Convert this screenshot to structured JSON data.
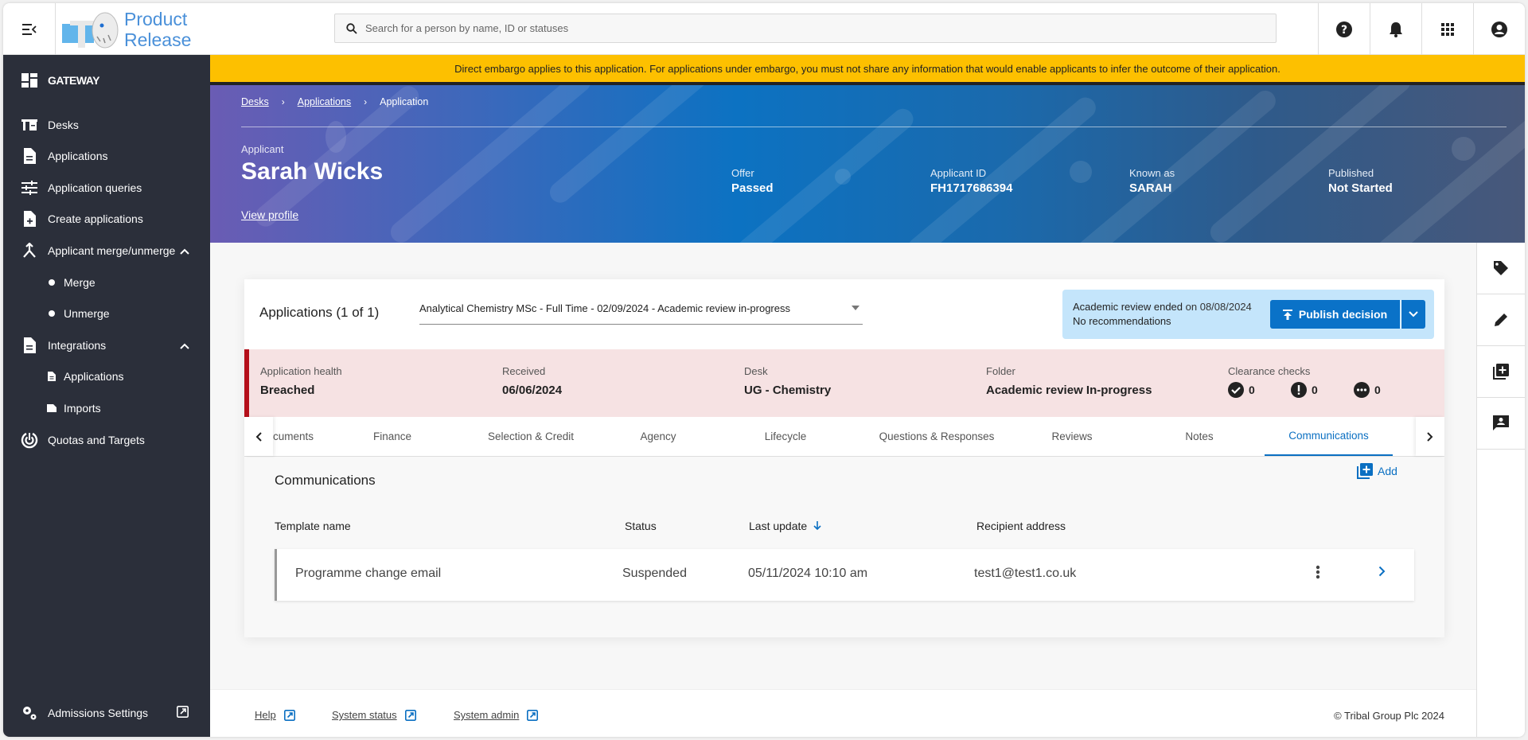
{
  "header": {
    "logo_text_line1": "Product",
    "logo_text_line2": "Release",
    "search_placeholder": "Search for a person by name, ID or statuses",
    "icons": [
      "help-icon",
      "bell-icon",
      "apps-grid-icon",
      "account-icon"
    ]
  },
  "sidebar": {
    "title": "GATEWAY",
    "items": [
      {
        "label": "Desks",
        "icon": "desk-icon"
      },
      {
        "label": "Applications",
        "icon": "document-icon"
      },
      {
        "label": "Application queries",
        "icon": "sliders-icon"
      },
      {
        "label": "Create applications",
        "icon": "document-add-icon"
      },
      {
        "label": "Applicant merge/unmerge",
        "icon": "merge-icon",
        "expanded": true,
        "children": [
          {
            "label": "Merge"
          },
          {
            "label": "Unmerge"
          }
        ]
      },
      {
        "label": "Integrations",
        "icon": "document-icon",
        "expanded": true,
        "children": [
          {
            "label": "Applications"
          },
          {
            "label": "Imports"
          }
        ]
      },
      {
        "label": "Quotas and Targets",
        "icon": "target-icon"
      }
    ],
    "bottom": {
      "label": "Admissions Settings"
    }
  },
  "banner": {
    "text": "Direct embargo applies to this application. For applications under embargo, you must not share any information that would enable applicants to infer the outcome of their application.",
    "color": "#fdc000"
  },
  "breadcrumb": [
    "Desks",
    "Applications",
    "Application"
  ],
  "applicant": {
    "label": "Applicant",
    "name": "Sarah Wicks",
    "view_profile": "View profile",
    "fields": [
      {
        "label": "Offer",
        "value": "Passed"
      },
      {
        "label": "Applicant ID",
        "value": "FH1717686394"
      },
      {
        "label": "Known as",
        "value": "SARAH"
      },
      {
        "label": "Published",
        "value": "Not Started"
      }
    ]
  },
  "applications": {
    "title": "Applications (1 of 1)",
    "selected": "Analytical Chemistry MSc - Full Time - 02/09/2024 - Academic review in-progress",
    "review": {
      "bold": "Academic review ended",
      "rest": " on 08/08/2024",
      "line2": "No recommendations"
    },
    "publish_label": "Publish decision"
  },
  "health": {
    "fields": [
      {
        "label": "Application health",
        "value": "Breached"
      },
      {
        "label": "Received",
        "value": "06/06/2024"
      },
      {
        "label": "Desk",
        "value": "UG - Chemistry"
      },
      {
        "label": "Folder",
        "value": "Academic review In-progress"
      }
    ],
    "clearance": {
      "label": "Clearance checks",
      "passed": "0",
      "warning": "0",
      "pending": "0"
    },
    "accent": "#b40f1a"
  },
  "tabs": [
    {
      "label": "cuments"
    },
    {
      "label": "Finance"
    },
    {
      "label": "Selection & Credit"
    },
    {
      "label": "Agency"
    },
    {
      "label": "Lifecycle"
    },
    {
      "label": "Questions & Responses"
    },
    {
      "label": "Reviews"
    },
    {
      "label": "Notes"
    },
    {
      "label": "Communications",
      "active": true
    }
  ],
  "communications": {
    "title": "Communications",
    "add_label": "Add",
    "columns": [
      "Template name",
      "Status",
      "Last update",
      "Recipient address"
    ],
    "rows": [
      {
        "template": "Programme change email",
        "status": "Suspended",
        "last_update": "05/11/2024 10:10 am",
        "recipient": "test1@test1.co.uk"
      }
    ]
  },
  "footer": {
    "links": [
      "Help",
      "System status",
      "System admin"
    ],
    "copyright": "© Tribal Group Plc 2024"
  },
  "colors": {
    "primary": "#0a72c8",
    "sidebar": "#2b2f3a",
    "review_bg": "#c4e5fb",
    "health_bg": "#f6e2e3"
  }
}
